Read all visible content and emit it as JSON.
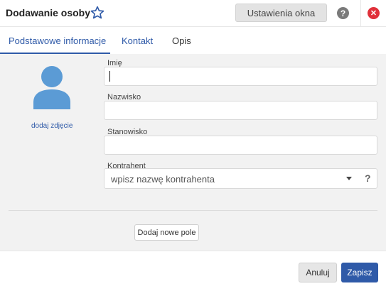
{
  "header": {
    "title": "Dodawanie osoby",
    "settings_label": "Ustawienia okna",
    "help_label": "?",
    "close_label": "✕"
  },
  "tabs": [
    {
      "label": "Podstawowe informacje",
      "active": true
    },
    {
      "label": "Kontakt",
      "active": false
    },
    {
      "label": "Opis",
      "active": false
    }
  ],
  "photo": {
    "add_label": "dodaj zdjęcie"
  },
  "fields": {
    "first_name": {
      "label": "Imię",
      "value": ""
    },
    "last_name": {
      "label": "Nazwisko",
      "value": ""
    },
    "position": {
      "label": "Stanowisko",
      "value": ""
    },
    "contractor": {
      "label": "Kontrahent",
      "placeholder": "wpisz nazwę kontrahenta",
      "help": "?"
    }
  },
  "add_field_label": "Dodaj nowe pole",
  "footer": {
    "cancel_label": "Anuluj",
    "save_label": "Zapisz"
  },
  "colors": {
    "accent": "#2f5aa8",
    "avatar": "#5b9bd5",
    "close": "#e0303a",
    "body_bg": "#f2f2f2"
  }
}
